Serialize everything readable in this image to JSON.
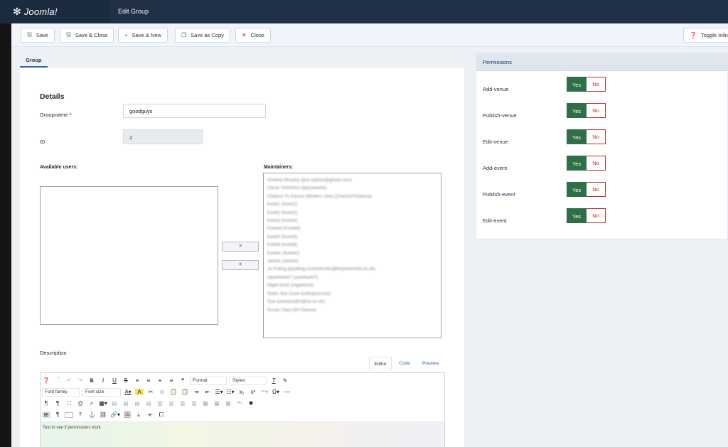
{
  "header": {
    "logo_text": "Joomla!",
    "page_title": "Edit Group"
  },
  "toolbar": {
    "save": "Save",
    "save_close": "Save & Close",
    "save_new": "Save & New",
    "save_copy": "Save as Copy",
    "close": "Close",
    "toggle": "Toggle Inlin"
  },
  "tabs": {
    "group": "Group"
  },
  "details": {
    "heading": "Details",
    "groupname_label": "Groupname *",
    "groupname_value": "goodguys",
    "id_label": "ID",
    "id_value": "2"
  },
  "users": {
    "available_label": "Available users:",
    "maintainers_label": "Maintainers:",
    "move_right": ">",
    "move_left": "<",
    "maintainers": [
      "Andrew Murphy (jive.stylists@gmail.com)",
      "Ceroc Yorkshire (bpryanevis)",
      "Chance To Dance (Modern Jive) (ChanceToDance)",
      "frank1 (frank1)",
      "frank2 (frank2)",
      "frank3 (frank3)",
      "Frank4 (Frank4)",
      "frank5 (frank5)",
      "frank6 (frank6)",
      "franktc (franktc)",
      "Janice (Janice)",
      "Jo Paling (jopaling.e1windowfix@btopenworld.co.uk)",
      "namefrank7 (userfrank7)",
      "Nigel Duck (nigelduck)",
      "Notts Jive Crew (nottsjivecrew)",
      "Sue (suesaul@sdjive.co.uk)",
      "Susan Saul (SH Dance)"
    ]
  },
  "description": {
    "label": "Description",
    "tab_editor": "Editor",
    "tab_code": "Code",
    "tab_preview": "Preview",
    "format": "Format",
    "styles": "Styles",
    "font_family": "Font family",
    "font_size": "Font size",
    "content": "Test to see if permissions work"
  },
  "permissions": {
    "title": "Permissions",
    "yes": "Yes",
    "no": "No",
    "items": [
      {
        "label": "Add-venue",
        "value": "Yes"
      },
      {
        "label": "Publish-venue",
        "value": "Yes"
      },
      {
        "label": "Edit-venue",
        "value": "Yes"
      },
      {
        "label": "Add-event",
        "value": "Yes"
      },
      {
        "label": "Publish-event",
        "value": "Yes"
      },
      {
        "label": "Edit-event",
        "value": "Yes"
      }
    ]
  },
  "colors": {
    "header_bg": "#1f3047",
    "yes_green": "#2d7047",
    "no_red": "#c42a2a",
    "active_tab": "#2f64a8"
  }
}
